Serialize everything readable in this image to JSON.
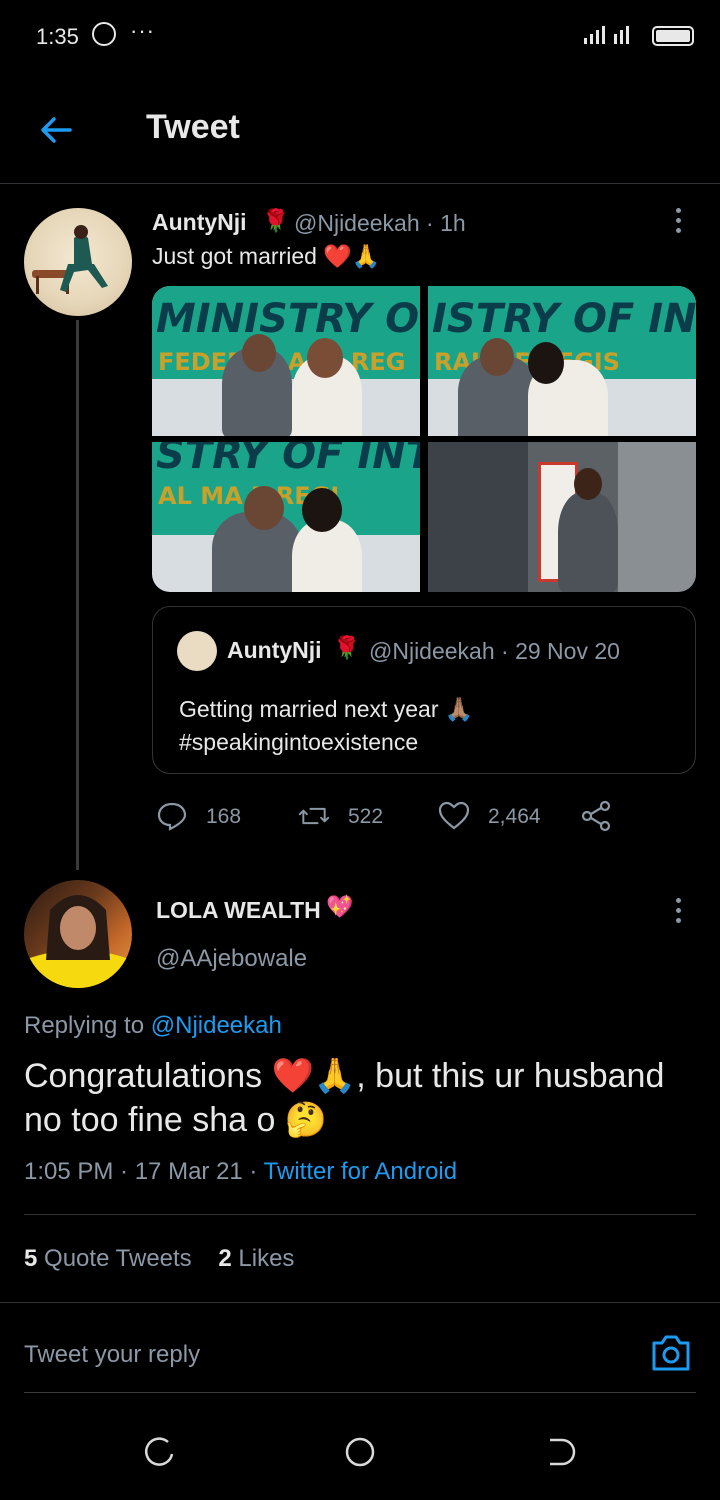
{
  "status_bar": {
    "time": "1:35",
    "signal": "..ıl ᯤıl"
  },
  "header": {
    "title": "Tweet"
  },
  "quoted_tweet": {
    "author": "AuntyNji",
    "emoji": "🌹",
    "handle_time": "@Njideekah · 1h",
    "text": "Just got married ❤️🙏",
    "photos": [
      {
        "line1": "MINISTRY OF INTE",
        "line2": "FEDERAL    AGE REG"
      },
      {
        "line1": "ISTRY OF INTER",
        "line2": "RAL      GE REGIS"
      },
      {
        "line1": "STRY OF INTER",
        "line2": "AL MA     E REGI"
      }
    ],
    "embedded": {
      "author": "AuntyNji",
      "emoji": "🌹",
      "handle_time": "@Njideekah · 29 Nov 20",
      "text": "Getting married next year 🙏🏽 #speakingintoexistence"
    },
    "actions": {
      "replies": "168",
      "retweets": "522",
      "likes": "2,464"
    }
  },
  "main_tweet": {
    "author": "LOLA WEALTH",
    "emoji": "💖",
    "handle": "@AAjebowale",
    "replying_prefix": "Replying to ",
    "replying_to": "@Njideekah",
    "text": "Congratulations ❤️🙏, but this ur husband no too fine sha o 🤔",
    "time_date": "1:05 PM · 17 Mar 21 · ",
    "source": "Twitter for Android",
    "quote_tweets_count": "5",
    "quote_tweets_label": "Quote Tweets",
    "likes_count": "2",
    "likes_label": "Likes"
  },
  "composer": {
    "placeholder": "Tweet your reply"
  },
  "colors": {
    "accent": "#1d9bf0",
    "background": "#000000",
    "muted": "#8b98a5"
  }
}
